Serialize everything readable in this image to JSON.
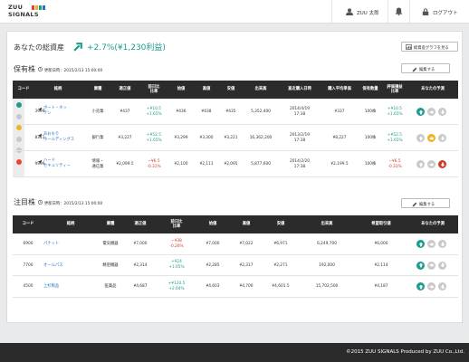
{
  "header": {
    "logo_line1": "ZUU",
    "logo_line2": "SIGNALS",
    "user_name": "ZUU 太郎",
    "logout": "ログアウト",
    "logo_colors": [
      "#e8423b",
      "#f0b323",
      "#1c9c8c",
      "#2a72c2"
    ]
  },
  "assets": {
    "title": "あなたの総資産",
    "change": "+2.7%(¥1,230利益)",
    "graph_button": "総資産グラフを見る"
  },
  "holdings": {
    "title": "保有株",
    "updated": "更新日時：2015/2/13 15:00:00",
    "edit_button": "編集する",
    "headers": [
      "コード",
      "銘柄",
      "業種",
      "適正値",
      "前日比\n比率",
      "始値",
      "高値",
      "安値",
      "出来高",
      "直近購入日時",
      "購入平均単価",
      "保有数量",
      "評価損益\n比率",
      "あなたの予測"
    ],
    "rows": [
      {
        "status": "#1c9c8c",
        "code": "3999",
        "name_l1": "ボート・ネッ",
        "name_l2": "テン",
        "industry": "小売業",
        "fair": "¥437",
        "diff1": "+¥10.5",
        "diff2": "+1.65%",
        "dir": "up",
        "open": "¥436",
        "high": "¥438",
        "low": "¥435",
        "volume": "5,352,400",
        "date1": "2014/4/19",
        "date2": "17:38",
        "avg": "¥337",
        "qty": "100株",
        "pl1": "+¥10.5",
        "pl2": "+1.65%",
        "pl_dir": "up",
        "prediction": "up"
      },
      {
        "status": "#f0b323",
        "code": "8311",
        "name_l1": "あおもり",
        "name_l2": "ホールディングス",
        "industry": "銀行業",
        "fair": "¥3,227",
        "diff1": "+¥52.5",
        "diff2": "+1.65%",
        "dir": "up",
        "open": "¥3,299",
        "high": "¥3,300",
        "low": "¥3,221",
        "volume": "16,362,200",
        "date1": "2013/2/19",
        "date2": "17:38",
        "avg": "¥8,227",
        "qty": "100株",
        "pl1": "+¥52.5",
        "pl2": "+1.65%",
        "pl_dir": "up",
        "prediction": "flat"
      },
      {
        "status": "#e8423b",
        "code": "9999",
        "name_l1": "ハード",
        "name_l2": "セキュリティー",
        "industry": "情報・\n通信業",
        "fair": "¥2,099.5",
        "diff1": "−¥6.5",
        "diff2": "-0.31%",
        "dir": "down",
        "open": "¥2,100",
        "high": "¥2,111",
        "low": "¥2,095",
        "volume": "5,877,600",
        "date1": "2014/2/20",
        "date2": "17:38",
        "avg": "¥2,199.5",
        "qty": "100株",
        "pl1": "−¥6.5",
        "pl2": "-0.31%",
        "pl_dir": "down",
        "prediction": "down"
      }
    ]
  },
  "watchlist": {
    "title": "注目株",
    "updated": "更新日時：2015/2/13 15:00:00",
    "edit_button": "編集する",
    "headers": [
      "コード",
      "銘柄",
      "業種",
      "適正値",
      "前日比\n比率",
      "始値",
      "高値",
      "安値",
      "出来高",
      "希望取引値",
      "あなたの予測"
    ],
    "rows": [
      {
        "code": "6900",
        "name": "パナット",
        "industry": "電気機器",
        "fair": "¥7,000",
        "diff1": "−¥38",
        "diff2": "-0.26%",
        "dir": "down",
        "open": "¥7,000",
        "high": "¥7,022",
        "low": "¥6,971",
        "volume": "6,249,700",
        "target": "¥6,000",
        "prediction": "up"
      },
      {
        "code": "7700",
        "name": "オールパス",
        "industry": "精密機器",
        "fair": "¥2,314",
        "diff1": "+¥24",
        "diff2": "+1.05%",
        "dir": "up",
        "open": "¥2,285",
        "high": "¥2,317",
        "low": "¥2,271",
        "volume": "192,000",
        "target": "¥2,114",
        "prediction": "up"
      },
      {
        "code": "4500",
        "name": "上杉製品",
        "industry": "医薬品",
        "fair": "¥4,687",
        "diff1": "+¥120.5",
        "diff2": "+2.64%",
        "dir": "up",
        "open": "¥4,603",
        "high": "¥4,700",
        "low": "¥4,601.5",
        "volume": "15,702,500",
        "target": "¥4,187",
        "prediction": "up"
      }
    ]
  },
  "footer": {
    "copyright": "©2015 ZUU SIGNALS Produced by ZUU Co.,Ltd."
  },
  "colors": {
    "up": "#1c9c8c",
    "down": "#d0392c",
    "flat": "#f0b323",
    "neutral": "#c9c9c9",
    "link": "#2a72c2"
  }
}
